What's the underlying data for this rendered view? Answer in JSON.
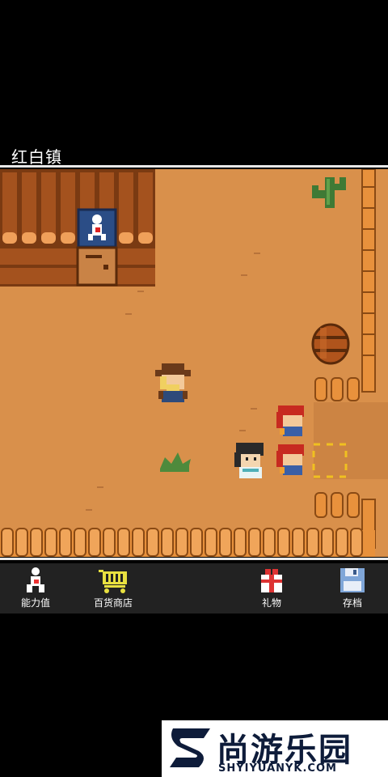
{
  "location": {
    "name": "红白镇"
  },
  "menu": [
    {
      "id": "stats",
      "label": "能力值",
      "icon": "stats-figure-icon"
    },
    {
      "id": "shop",
      "label": "百货商店",
      "icon": "shopping-cart-icon"
    },
    {
      "id": "gift",
      "label": "礼物",
      "icon": "gift-box-icon"
    },
    {
      "id": "save",
      "label": "存档",
      "icon": "floppy-disk-icon"
    }
  ],
  "watermark": {
    "title": "尚游乐园",
    "subtitle": "SHYIYUANYK.COM"
  },
  "colors": {
    "ground": "#d9904b",
    "wood": "#a4521e",
    "fence": "#e8913c",
    "menu_bg": "#222222"
  }
}
